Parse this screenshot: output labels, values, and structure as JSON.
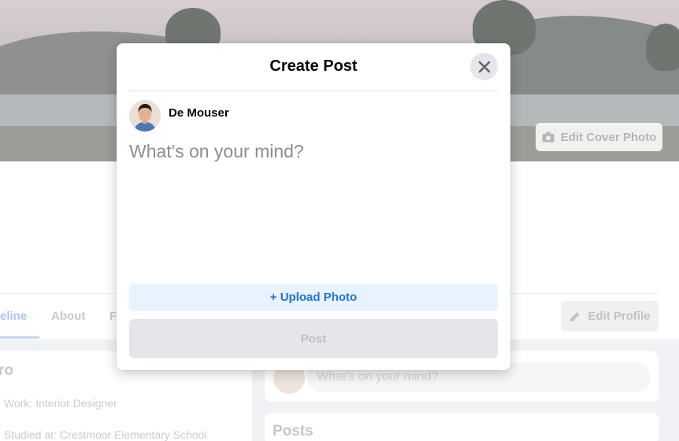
{
  "modal": {
    "title": "Create Post",
    "author_name": "De Mouser",
    "textarea_placeholder": "What's on your mind?",
    "upload_label": "+ Upload Photo",
    "post_label": "Post",
    "close_icon": "close-icon"
  },
  "background": {
    "edit_cover_label": "Edit Cover Photo",
    "edit_profile_label": "Edit Profile",
    "tabs": [
      "eline",
      "About",
      "F"
    ],
    "intro_title": "ro",
    "intro_lines": [
      "Work: Interior Designer",
      "Studied at: Crestmoor Elementary School"
    ],
    "composer_placeholder": "What's on your mind?",
    "posts_title": "Posts"
  },
  "colors": {
    "accent": "#1b74e4",
    "upload_bg": "#e7f3ff",
    "disabled_button_bg": "#e4e6eb"
  }
}
